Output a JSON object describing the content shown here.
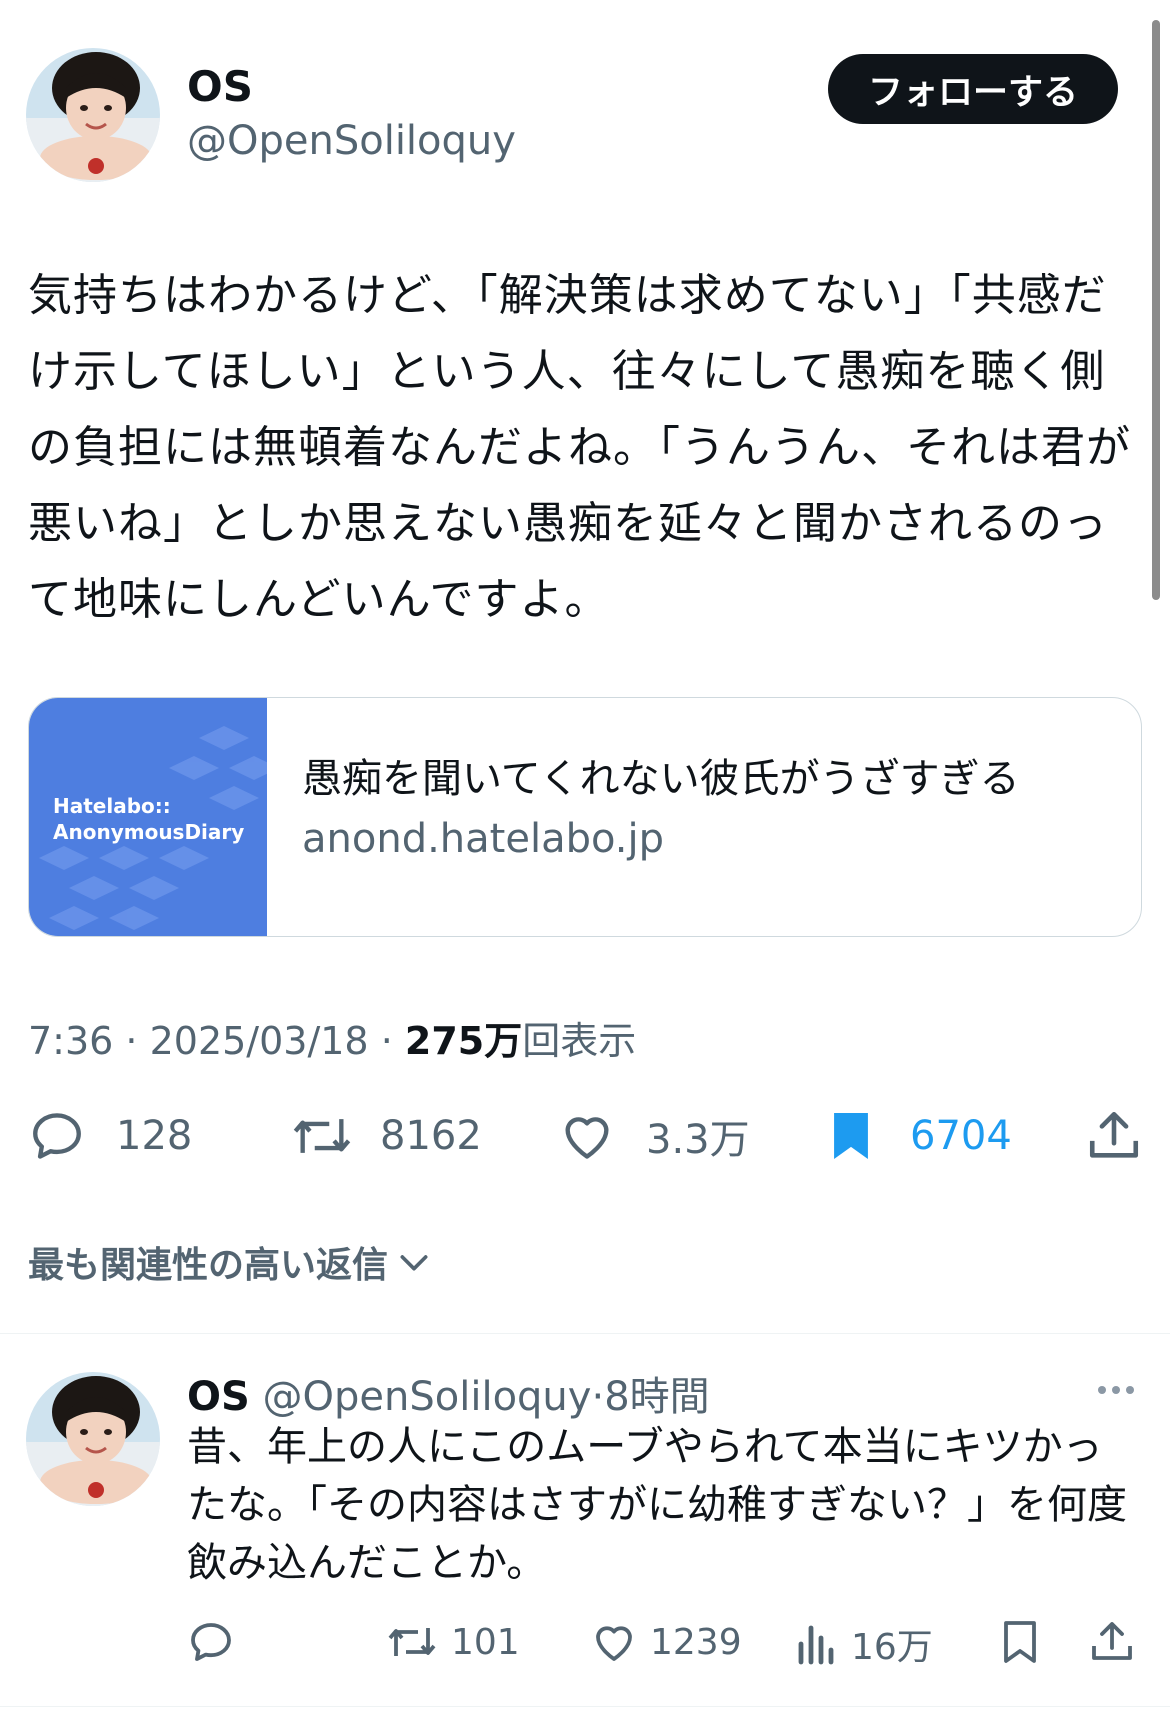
{
  "tweet": {
    "author_name": "OS",
    "author_handle": "@OpenSoliloquy",
    "follow_label": "フォローする",
    "text": "気持ちはわかるけど、「解決策は求めてない」「共感だけ示してほしい」という人、往々にして愚痴を聴く側の負担には無頓着なんだよね。「うんうん、それは君が悪いね」としか思えない愚痴を延々と聞かされるのって地味にしんどいんですよ。",
    "card": {
      "thumb_line1": "Hatelabo::",
      "thumb_line2": "AnonymousDiary",
      "title": "愚痴を聞いてくれない彼氏がうざすぎる",
      "domain": "anond.hatelabo.jp"
    },
    "time": "7:36",
    "sep1": " · ",
    "date": "2025/03/18",
    "sep2": " · ",
    "views_count": "275万",
    "views_label": "回表示",
    "stats": {
      "replies": "128",
      "retweets": "8162",
      "likes": "3.3万",
      "bookmarks": "6704"
    }
  },
  "replies_section": {
    "sort_label": "最も関連性の高い返信"
  },
  "reply": {
    "author_name": "OS",
    "author_handle": "@OpenSoliloquy",
    "dot": "·",
    "time": "8時間",
    "text": "昔、年上の人にこのムーブやられて本当にキツかったな。「その内容はさすがに幼稚すぎない？」を何度飲み込んだことか。",
    "stats": {
      "retweets": "101",
      "likes": "1239",
      "views": "16万"
    }
  },
  "colors": {
    "text": "#0f1419",
    "secondary": "#536471",
    "bookmark_active": "#1d9bf0",
    "card_thumb": "#4e7ee0"
  }
}
